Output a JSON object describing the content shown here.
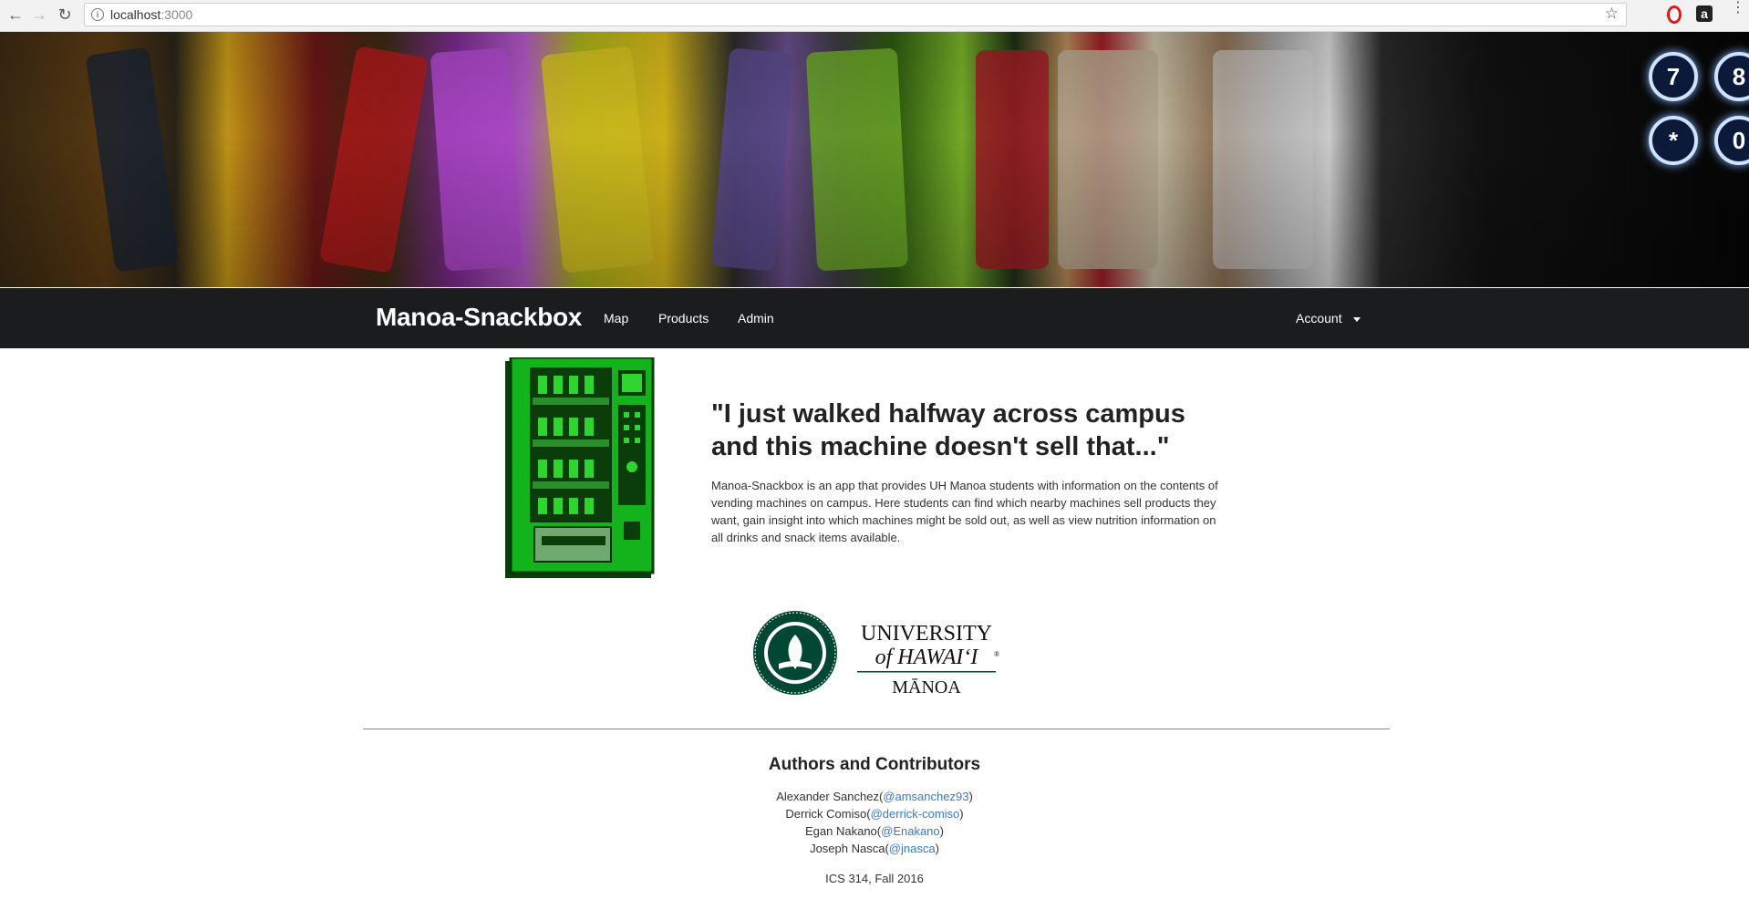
{
  "browser": {
    "url_host": "localhost",
    "url_port": ":3000",
    "icons": [
      "back-icon",
      "forward-icon",
      "reload-icon",
      "info-icon",
      "star-icon",
      "opera-icon",
      "amazon-icon",
      "menu-icon"
    ],
    "amazon_badge": "a"
  },
  "hero": {
    "image": "vending-machine-snacks-photo",
    "keypad": [
      "7",
      "8",
      "*",
      "0"
    ]
  },
  "navbar": {
    "brand": "Manoa-Snackbox",
    "links": [
      "Map",
      "Products",
      "Admin"
    ],
    "account": "Account"
  },
  "intro": {
    "quote": "\"I just walked halfway across campus and this machine doesn't sell that...\"",
    "description": "Manoa-Snackbox is an app that provides UH Manoa students with information on the contents of vending machines on campus. Here students can find which nearby machines sell products they want, gain insight into which machines might be sold out, as well as view nutrition information on all drinks and snack items available."
  },
  "logo": {
    "line1": "UNIVERSITY",
    "line2": "of HAWAIʻI",
    "line3": "MĀNOA",
    "registered": "®",
    "seal_text": "UNIVERSITY OF HAWAIʻI"
  },
  "footer": {
    "title": "Authors and Contributors",
    "authors": [
      {
        "name": "Alexander Sanchez",
        "handle": "@amsanchez93"
      },
      {
        "name": "Derrick Comiso",
        "handle": "@derrick-comiso"
      },
      {
        "name": "Egan Nakano",
        "handle": "@Enakano"
      },
      {
        "name": "Joseph Nasca",
        "handle": "@jnasca"
      }
    ],
    "course": "ICS 314, Fall 2016"
  },
  "colors": {
    "navbar": "#1b1c1d",
    "link": "#3a78c9",
    "machine_green": "#13b41b",
    "uh_green": "#024731"
  }
}
